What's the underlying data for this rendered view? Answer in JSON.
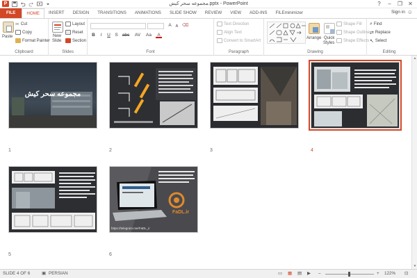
{
  "titlebar": {
    "app_badge": "P",
    "title": "مجموعه سحر کیش.pptx - PowerPoint",
    "qat": [
      "save-icon",
      "undo-icon",
      "redo-icon",
      "start-from-beginning-icon",
      "customize-icon"
    ],
    "help": "?",
    "minimize": "–",
    "restore": "❐",
    "close": "✕"
  },
  "tabs": [
    {
      "label": "FILE",
      "kind": "file"
    },
    {
      "label": "HOME",
      "kind": "active"
    },
    {
      "label": "INSERT",
      "kind": "normal"
    },
    {
      "label": "DESIGN",
      "kind": "normal"
    },
    {
      "label": "TRANSITIONS",
      "kind": "normal"
    },
    {
      "label": "ANIMATIONS",
      "kind": "normal"
    },
    {
      "label": "SLIDE SHOW",
      "kind": "normal"
    },
    {
      "label": "REVIEW",
      "kind": "normal"
    },
    {
      "label": "VIEW",
      "kind": "normal"
    },
    {
      "label": "ADD-INS",
      "kind": "normal"
    },
    {
      "label": "FILEminimizer",
      "kind": "normal"
    }
  ],
  "signin": "Sign in",
  "ribbon": {
    "clipboard": {
      "label": "Clipboard",
      "paste": "Paste",
      "cut": "Cut",
      "copy": "Copy",
      "format_painter": "Format Painter"
    },
    "slides": {
      "label": "Slides",
      "new_slide_1": "New",
      "new_slide_2": "Slide",
      "layout": "Layout",
      "reset": "Reset",
      "section": "Section"
    },
    "font": {
      "label": "Font",
      "bold": "B",
      "italic": "I",
      "underline": "U",
      "strike": "S",
      "shadow": "abc",
      "spacing": "AV",
      "case": "Aa",
      "color": "A"
    },
    "paragraph": {
      "label": "Paragraph",
      "text_direction": "Text Direction",
      "align_text": "Align Text",
      "convert_smartart": "Convert to SmartArt"
    },
    "drawing": {
      "label": "Drawing",
      "arrange": "Arrange",
      "quick_styles_1": "Quick",
      "quick_styles_2": "Styles",
      "shape_fill": "Shape Fill",
      "shape_outline": "Shape Outline",
      "shape_effects": "Shape Effects"
    },
    "editing": {
      "label": "Editing",
      "find": "Find",
      "replace": "Replace",
      "select": "Select"
    }
  },
  "slides": [
    {
      "number": "1",
      "title_text": "مجموعه سحر کیش",
      "selected": false
    },
    {
      "number": "2",
      "selected": false
    },
    {
      "number": "3",
      "selected": false
    },
    {
      "number": "4",
      "selected": true
    },
    {
      "number": "5",
      "selected": false
    },
    {
      "number": "6",
      "selected": false,
      "logo_text": "FaDL.ir",
      "link_text": "https://telegram.me/FaDL_ir"
    }
  ],
  "status": {
    "slide_counter": "SLIDE 4 OF 6",
    "language": "PERSIAN",
    "zoom": "122%"
  },
  "colors": {
    "accent": "#d24726",
    "selected_outline": "#d24726"
  }
}
